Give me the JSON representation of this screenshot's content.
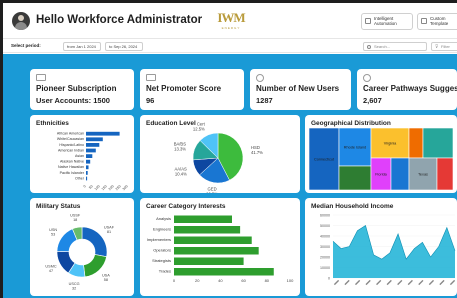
{
  "header": {
    "greeting": "Hello Workforce Administrator",
    "logo_text": "IWM",
    "logo_sub": "ENERGY",
    "buttons": [
      {
        "line1": "Intelligent",
        "line2": "Automation"
      },
      {
        "line1": "Custom",
        "line2": "Template"
      }
    ]
  },
  "filter": {
    "label": "Select period:",
    "from": "from Jan 1 2024",
    "to": "to Sep 26, 2024",
    "search_placeholder": "Search...",
    "filter_label": "Filter"
  },
  "kpis": [
    {
      "title": "Pioneer Subscription",
      "value": "User Accounts: 1500"
    },
    {
      "title": "Net Promoter Score",
      "value": "96"
    },
    {
      "title": "Number of New Users",
      "value": "1287"
    },
    {
      "title": "Career Pathways Suggested",
      "value": "2,607"
    }
  ],
  "colors": {
    "dashboard_bg": "#1a9ad6",
    "accent_blue": "#1565c0",
    "accent_green": "#2e9e2e",
    "card_bg": "#ffffff"
  },
  "chart_data": [
    {
      "id": "ethnicities",
      "type": "bar",
      "orientation": "horizontal",
      "title": "Ethnicities",
      "categories": [
        "African American",
        "White/Caucasian",
        "Hispanic/Latino",
        "American Indian",
        "Asian",
        "Alaskan Native",
        "Native Hawaiian",
        "Pacific Islander",
        "Other"
      ],
      "values": [
        240,
        120,
        95,
        70,
        45,
        30,
        18,
        12,
        8
      ],
      "xticks": [
        "0",
        "50",
        "100",
        "150",
        "200",
        "250",
        "300"
      ],
      "xlim": [
        0,
        300
      ],
      "color": "#1565c0"
    },
    {
      "id": "education",
      "type": "pie",
      "title": "Education Level",
      "slices": [
        {
          "label": "HSD",
          "pct_label": "41.7%",
          "value": 41.7,
          "color": "#3dbb3d"
        },
        {
          "label": "GED",
          "pct_label": "20.5%",
          "value": 20.5,
          "color": "#1976d2"
        },
        {
          "label": "AA/AS",
          "pct_label": "10.4%",
          "value": 10.4,
          "color": "#0d47a1"
        },
        {
          "label": "BA/BS",
          "pct_label": "13.3%",
          "value": 13.3,
          "color": "#26a69a"
        },
        {
          "label": "Cert",
          "pct_label": "12.5%",
          "value": 12.5,
          "color": "#4fc3f7"
        }
      ]
    },
    {
      "id": "geo",
      "type": "treemap",
      "title": "Geographical Distribution",
      "cells": [
        {
          "label": "Connecticut",
          "color": "#1565c0"
        },
        {
          "label": "Rhode Island",
          "color": "#1e88e5"
        },
        {
          "label": "Virginia",
          "color": "#fbc02d"
        },
        {
          "label": "",
          "color": "#ef6c00"
        },
        {
          "label": "",
          "color": "#26a69a"
        },
        {
          "label": "",
          "color": "#2e7d32"
        },
        {
          "label": "Florida",
          "color": "#e040fb"
        },
        {
          "label": "",
          "color": "#1976d2"
        },
        {
          "label": "Texas",
          "color": "#90a4ae"
        },
        {
          "label": "",
          "color": "#e53935"
        }
      ]
    },
    {
      "id": "military",
      "type": "pie",
      "subtype": "donut",
      "title": "Military Status",
      "slices": [
        {
          "label": "USAF",
          "value_label": "81",
          "value": 81,
          "color": "#1565c0"
        },
        {
          "label": "USA",
          "value_label": "58",
          "value": 58,
          "color": "#2e9e2e"
        },
        {
          "label": "USCG",
          "value_label": "32",
          "value": 32,
          "color": "#4fc3f7"
        },
        {
          "label": "USMC",
          "value_label": "47",
          "value": 47,
          "color": "#0d47a1"
        },
        {
          "label": "USN",
          "value_label": "53",
          "value": 53,
          "color": "#1e88e5"
        },
        {
          "label": "USSF",
          "value_label": "18",
          "value": 18,
          "color": "#66bb6a"
        }
      ]
    },
    {
      "id": "career",
      "type": "bar",
      "orientation": "horizontal",
      "title": "Career Category Interests",
      "categories": [
        "Analysis",
        "Engineers",
        "Implementers",
        "Operators",
        "Strategists",
        "Trades"
      ],
      "values": [
        50,
        57,
        67,
        73,
        60,
        86
      ],
      "xticks": [
        "0",
        "20",
        "40",
        "60",
        "80",
        "100"
      ],
      "xlim": [
        0,
        100
      ],
      "color": "#2e9e2e"
    },
    {
      "id": "income",
      "type": "area",
      "title": "Median Household Income",
      "yticks": [
        "60000",
        "50000",
        "40000",
        "30000",
        "20000",
        "10000",
        "0"
      ],
      "ylim": [
        0,
        60000
      ],
      "values": [
        35000,
        28000,
        30000,
        45000,
        50000,
        22000,
        18000,
        24000,
        42000,
        18000,
        28000,
        34000,
        20000,
        30000,
        48000,
        26000
      ],
      "color": "#1ab2d6",
      "x_tick_count": 12
    }
  ]
}
